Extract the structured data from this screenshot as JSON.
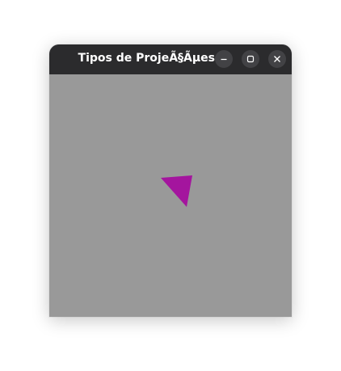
{
  "window": {
    "title": "Tipos de ProjeÃ§Ãµes"
  },
  "controls": {
    "minimize_icon": "minimize-icon",
    "maximize_icon": "maximize-icon",
    "close_icon": "close-icon"
  },
  "scene": {
    "background_color": "#999999",
    "shape": "triangle",
    "shape_color": "#a4159e"
  }
}
